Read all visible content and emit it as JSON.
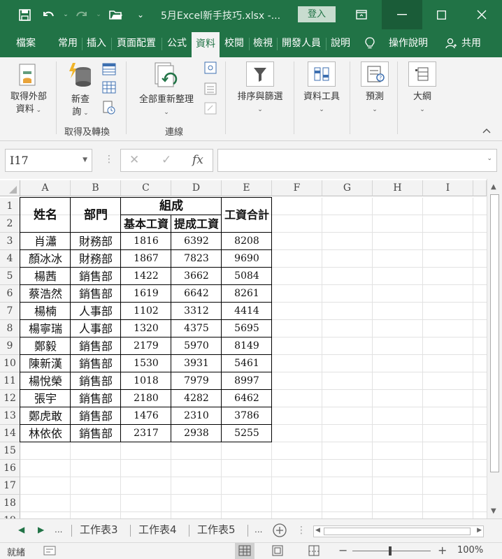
{
  "titlebar": {
    "title": "5月Excel新手技巧.xlsx  -...",
    "login_label": "登入",
    "save_icon": "save-icon",
    "undo_icon": "undo-icon",
    "redo_icon": "redo-icon",
    "open_icon": "open-folder-icon"
  },
  "tabs": [
    "檔案",
    "常用",
    "插入",
    "頁面配置",
    "公式",
    "資料",
    "校閱",
    "檢視",
    "開發人員",
    "說明",
    "操作說明",
    "共用"
  ],
  "active_tab": "資料",
  "ribbon": {
    "get_external": [
      "取得外部",
      "資料"
    ],
    "new_query": [
      "新查",
      "詢"
    ],
    "group1_label": "取得及轉換",
    "refresh_all": "全部重新整理",
    "group2_label": "連線",
    "sort_filter": "排序與篩選",
    "data_tools": "資料工具",
    "forecast": "預測",
    "outline": "大綱"
  },
  "formula_bar": {
    "name_box": "I17",
    "cancel": "✕",
    "enter": "✓",
    "fx": "fx",
    "value": ""
  },
  "columns": [
    "A",
    "B",
    "C",
    "D",
    "E",
    "F",
    "G",
    "H",
    "I"
  ],
  "rows": [
    "1",
    "2",
    "3",
    "4",
    "5",
    "6",
    "7",
    "8",
    "9",
    "10",
    "11",
    "12",
    "13",
    "14",
    "15",
    "16",
    "17",
    "18",
    "19"
  ],
  "table": {
    "header_name": "姓名",
    "header_dept": "部門",
    "header_group": "組成",
    "header_base": "基本工資",
    "header_bonus": "提成工資",
    "header_total": "工資合計",
    "rows": [
      [
        "肖瀟",
        "財務部",
        "1816",
        "6392",
        "8208"
      ],
      [
        "顏冰冰",
        "財務部",
        "1867",
        "7823",
        "9690"
      ],
      [
        "楊茜",
        "銷售部",
        "1422",
        "3662",
        "5084"
      ],
      [
        "蔡浩然",
        "銷售部",
        "1619",
        "6642",
        "8261"
      ],
      [
        "楊楠",
        "人事部",
        "1102",
        "3312",
        "4414"
      ],
      [
        "楊寧瑞",
        "人事部",
        "1320",
        "4375",
        "5695"
      ],
      [
        "鄭毅",
        "銷售部",
        "2179",
        "5970",
        "8149"
      ],
      [
        "陳新漢",
        "銷售部",
        "1530",
        "3931",
        "5461"
      ],
      [
        "楊悅榮",
        "銷售部",
        "1018",
        "7979",
        "8997"
      ],
      [
        "張宇",
        "銷售部",
        "2180",
        "4282",
        "6462"
      ],
      [
        "鄭虎敢",
        "銷售部",
        "1476",
        "2310",
        "3786"
      ],
      [
        "林依依",
        "銷售部",
        "2317",
        "2938",
        "5255"
      ]
    ]
  },
  "sheets": {
    "ellipsis_left": "...",
    "tabs": [
      "工作表3",
      "工作表4",
      "工作表5"
    ],
    "ellipsis_right": "..."
  },
  "status": {
    "ready": "就緒",
    "zoom": "100%"
  }
}
